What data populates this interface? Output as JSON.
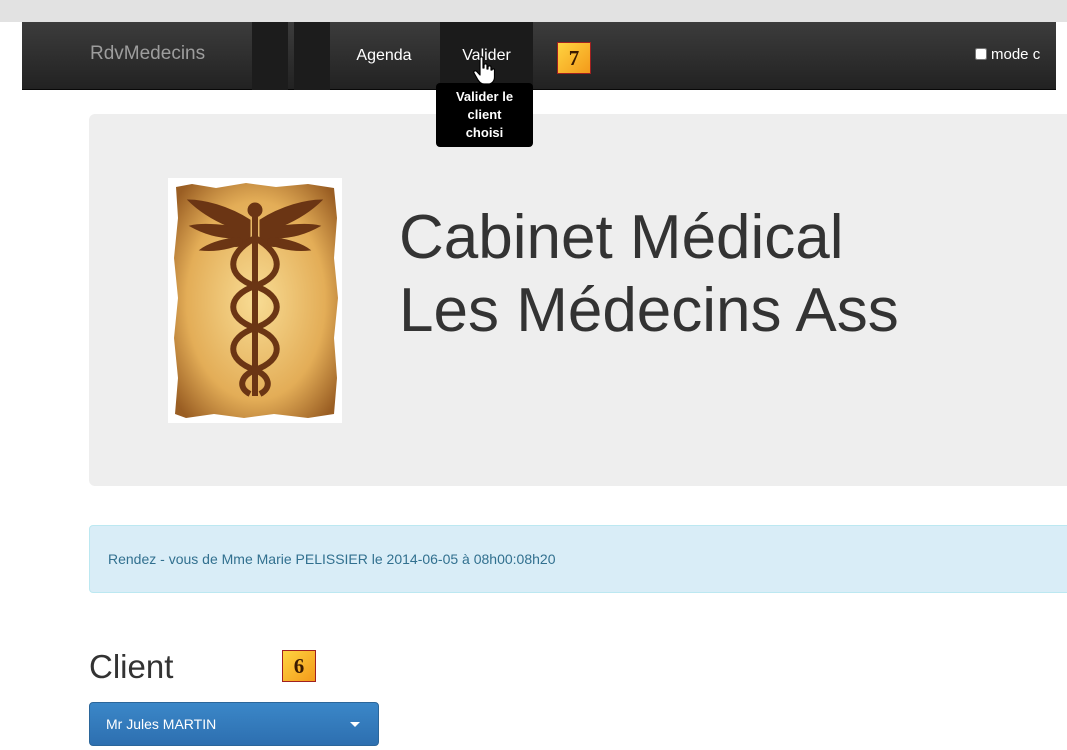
{
  "navbar": {
    "brand": "RdvMedecins",
    "items": [
      {
        "label": "Agenda"
      },
      {
        "label": "Valider"
      }
    ],
    "mode_label": "mode c",
    "tooltip_lines": [
      "Valider le",
      "client",
      "choisi"
    ]
  },
  "badges": {
    "valider": "7",
    "client": "6"
  },
  "jumbotron": {
    "title_line1": "Cabinet Médical",
    "title_line2": "Les Médecins Ass"
  },
  "alert": {
    "text": "Rendez - vous de Mme Marie PELISSIER le 2014-06-05 à 08h00:08h20"
  },
  "client": {
    "heading": "Client",
    "selected": "Mr Jules MARTIN"
  },
  "icons": {
    "logo": "caduceus-icon",
    "cursor": "hand-pointer-icon",
    "dropdown": "caret-down-icon"
  },
  "colors": {
    "navbar": "#222222",
    "alert_bg": "#d9edf7",
    "alert_text": "#31708f",
    "primary": "#337ab7",
    "badge": "#f8b62a"
  }
}
